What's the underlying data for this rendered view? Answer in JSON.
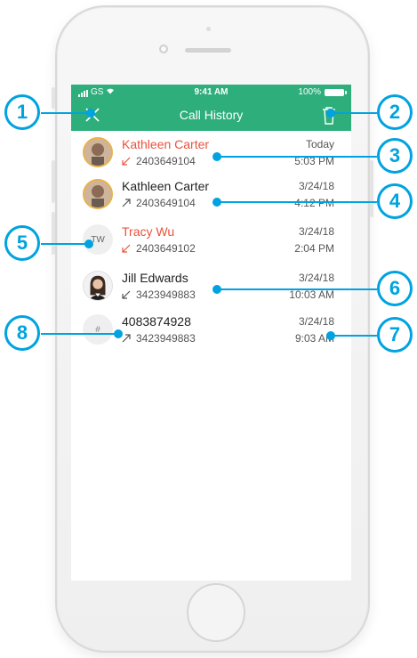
{
  "status_bar": {
    "carrier": "GS",
    "time": "9:41 AM",
    "battery": "100%"
  },
  "nav": {
    "title": "Call History"
  },
  "calls": [
    {
      "name": "Kathleen Carter",
      "number": "2403649104",
      "date": "Today",
      "time": "5:03 PM",
      "missed": true,
      "direction": "incoming",
      "avatar_type": "photo"
    },
    {
      "name": "Kathleen Carter",
      "number": "2403649104",
      "date": "3/24/18",
      "time": "4:12 PM",
      "missed": false,
      "direction": "outgoing",
      "avatar_type": "photo"
    },
    {
      "name": "Tracy Wu",
      "number": "2403649102",
      "date": "3/24/18",
      "time": "2:04 PM",
      "missed": true,
      "direction": "incoming",
      "avatar_type": "initials",
      "initials": "TW"
    },
    {
      "name": "Jill Edwards",
      "number": "3423949883",
      "date": "3/24/18",
      "time": "10:03 AM",
      "missed": false,
      "direction": "incoming",
      "avatar_type": "photo"
    },
    {
      "name": "4083874928",
      "number": "3423949883",
      "date": "3/24/18",
      "time": "9:03 AM",
      "missed": false,
      "direction": "outgoing",
      "avatar_type": "hash",
      "initials": "#"
    }
  ],
  "callouts": [
    "1",
    "2",
    "3",
    "4",
    "5",
    "6",
    "7",
    "8"
  ],
  "colors": {
    "header": "#2eae7b",
    "missed": "#e9523c",
    "callout": "#00a3df"
  }
}
